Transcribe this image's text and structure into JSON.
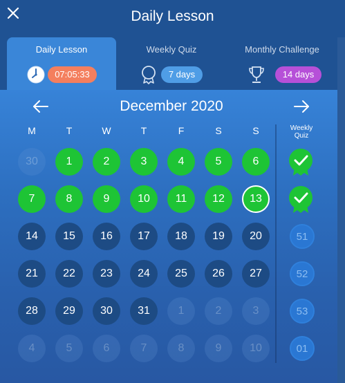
{
  "header": {
    "title": "Daily Lesson"
  },
  "tabs": [
    {
      "label": "Daily Lesson",
      "badge": "07:05:33",
      "badge_color": "#f47f5e",
      "icon": "clock-icon"
    },
    {
      "label": "Weekly Quiz",
      "badge": "7 days",
      "badge_color": "#4f9de6",
      "icon": "medal-icon"
    },
    {
      "label": "Monthly Challenge",
      "badge": "14 days",
      "badge_color": "#b650d8",
      "icon": "trophy-icon"
    }
  ],
  "calendar": {
    "month_title": "December 2020",
    "weekdays": [
      "M",
      "T",
      "W",
      "T",
      "F",
      "S",
      "S"
    ],
    "weekly_header": [
      "Weekly",
      "Quiz"
    ],
    "weeks": [
      [
        "30",
        "1",
        "2",
        "3",
        "4",
        "5",
        "6"
      ],
      [
        "7",
        "8",
        "9",
        "10",
        "11",
        "12",
        "13"
      ],
      [
        "14",
        "15",
        "16",
        "17",
        "18",
        "19",
        "20"
      ],
      [
        "21",
        "22",
        "23",
        "24",
        "25",
        "26",
        "27"
      ],
      [
        "28",
        "29",
        "30",
        "31",
        "1",
        "2",
        "3"
      ],
      [
        "4",
        "5",
        "6",
        "7",
        "8",
        "9",
        "10"
      ]
    ],
    "week_status": [
      [
        "faded",
        "done",
        "done",
        "done",
        "done",
        "done",
        "done"
      ],
      [
        "done",
        "done",
        "done",
        "done",
        "done",
        "done",
        "today"
      ],
      [
        "dark",
        "dark",
        "dark",
        "dark",
        "dark",
        "dark",
        "dark"
      ],
      [
        "dark",
        "dark",
        "dark",
        "dark",
        "dark",
        "dark",
        "dark"
      ],
      [
        "dark",
        "dark",
        "dark",
        "dark",
        "faded",
        "faded",
        "faded"
      ],
      [
        "faded",
        "faded",
        "faded",
        "faded",
        "faded",
        "faded",
        "faded"
      ]
    ],
    "weekly_quiz": [
      "",
      "",
      "51",
      "52",
      "53",
      "01"
    ],
    "weekly_quiz_status": [
      "check",
      "check",
      "num",
      "num",
      "num",
      "num"
    ]
  },
  "colors": {
    "completed": "#1ec435",
    "upcoming": "#1d4b84",
    "accent": "#3a86d8"
  }
}
